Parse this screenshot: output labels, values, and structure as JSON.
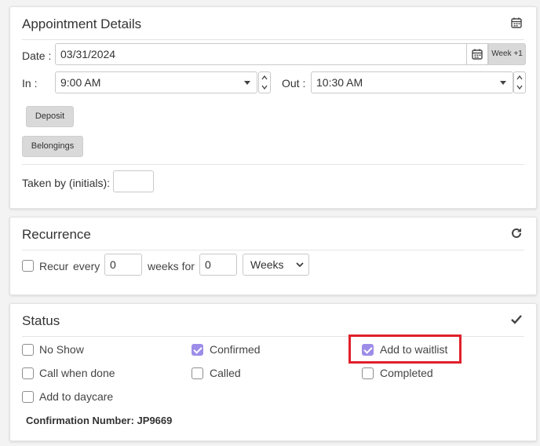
{
  "appointment": {
    "title": "Appointment Details",
    "date_label": "Date :",
    "date_value": "03/31/2024",
    "week_button": "Week +1",
    "in_label": "In :",
    "in_value": "9:00 AM",
    "out_label": "Out :",
    "out_value": "10:30 AM",
    "deposit_button": "Deposit",
    "belongings_button": "Belongings",
    "taken_by_label": "Taken by (initials):",
    "taken_by_value": ""
  },
  "recurrence": {
    "title": "Recurrence",
    "recur_label": "Recur",
    "recur_checked": false,
    "every_label": "every",
    "every_value": "0",
    "weeks_for_label": "weeks for",
    "weeks_for_value": "0",
    "unit_selected": "Weeks"
  },
  "status": {
    "title": "Status",
    "options": [
      {
        "label": "No Show",
        "checked": false
      },
      {
        "label": "Confirmed",
        "checked": true
      },
      {
        "label": "Add to waitlist",
        "checked": true
      },
      {
        "label": "Call when done",
        "checked": false
      },
      {
        "label": "Called",
        "checked": false
      },
      {
        "label": "Completed",
        "checked": false
      },
      {
        "label": "Add to daycare",
        "checked": false
      }
    ],
    "confirmation_text": "Confirmation Number: JP9669"
  },
  "colors": {
    "checkbox_checked": "#9d8de8",
    "highlight": "#e0202a"
  }
}
